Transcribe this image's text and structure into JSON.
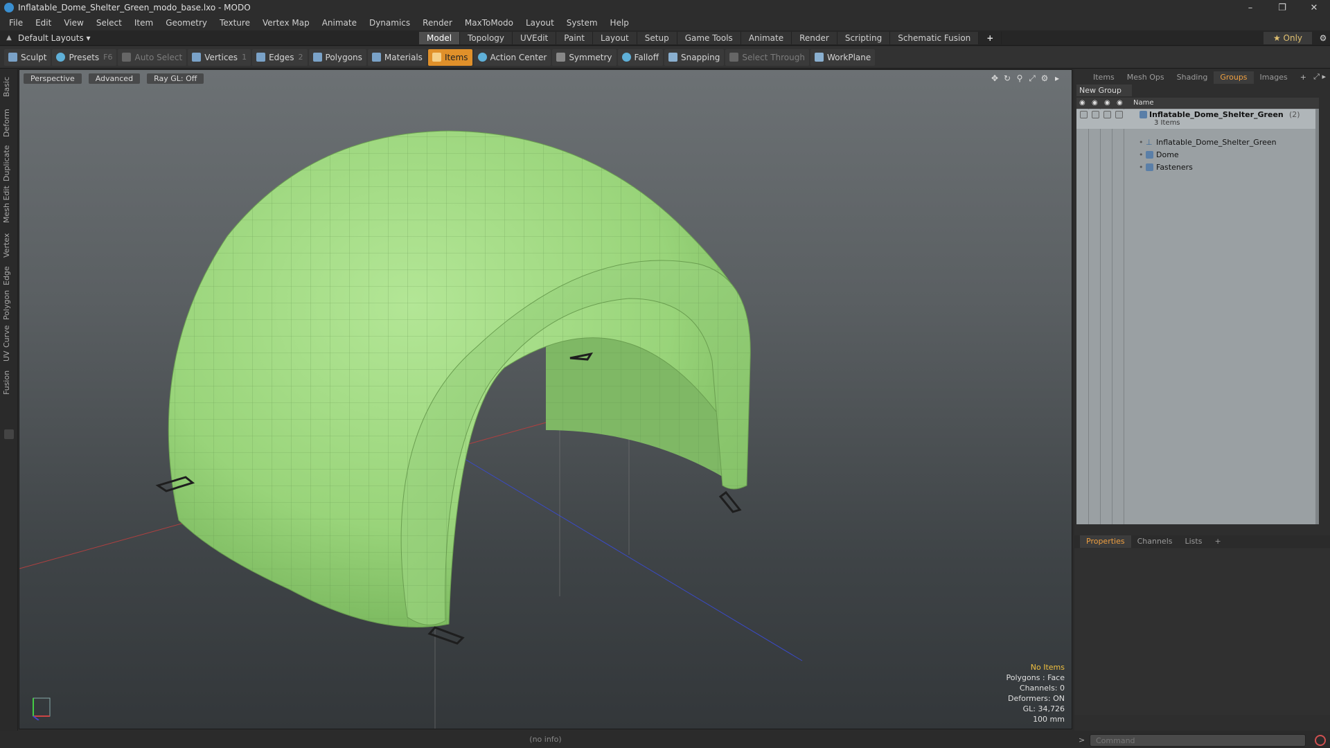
{
  "window": {
    "title": "Inflatable_Dome_Shelter_Green_modo_base.lxo - MODO",
    "minimize": "–",
    "restore": "❐",
    "close": "✕"
  },
  "menu": [
    "File",
    "Edit",
    "View",
    "Select",
    "Item",
    "Geometry",
    "Texture",
    "Vertex Map",
    "Animate",
    "Dynamics",
    "Render",
    "MaxToModo",
    "Layout",
    "System",
    "Help"
  ],
  "layoutbar": {
    "layouts": "Default Layouts ▾",
    "tabs": [
      "Model",
      "Topology",
      "UVEdit",
      "Paint",
      "Layout",
      "Setup",
      "Game Tools",
      "Animate",
      "Render",
      "Scripting",
      "Schematic Fusion"
    ],
    "active_tab": "Model",
    "add": "+",
    "only": "★ Only"
  },
  "toolbar": {
    "sculpt": "Sculpt",
    "presets": "Presets",
    "presets_key": "F6",
    "auto_select": "Auto Select",
    "vertices": "Vertices",
    "vertices_key": "1",
    "edges": "Edges",
    "edges_key": "2",
    "polygons": "Polygons",
    "materials": "Materials",
    "items": "Items",
    "action_center": "Action Center",
    "symmetry": "Symmetry",
    "falloff": "Falloff",
    "snapping": "Snapping",
    "select_through": "Select Through",
    "workplane": "WorkPlane"
  },
  "left_strip": [
    "Basic",
    "Deform",
    "Duplicate",
    "Mesh Edit",
    "Vertex",
    "Edge",
    "Polygon",
    "Curve",
    "UV",
    "Fusion"
  ],
  "viewport": {
    "view": "Perspective",
    "shading": "Advanced",
    "raygl": "Ray GL: Off",
    "stats": {
      "no_items": "No Items",
      "polygons": "Polygons : Face",
      "channels": "Channels: 0",
      "deformers": "Deformers: ON",
      "gl": "GL: 34,726",
      "unit": "100 mm"
    },
    "colors": {
      "dome": "#9bd77a",
      "dome_shadow": "#6fae54",
      "wire": "#5e8f4a"
    }
  },
  "status": "(no info)",
  "right_panel": {
    "tabs": [
      "Items",
      "Mesh Ops",
      "Shading",
      "Groups",
      "Images"
    ],
    "active_tab": "Groups",
    "add": "+",
    "new_group": "New Group",
    "column_name": "Name",
    "group": {
      "name": "Inflatable_Dome_Shelter_Green",
      "count": "(2)",
      "subtitle": "3 Items",
      "children": [
        "Inflatable_Dome_Shelter_Green",
        "Dome",
        "Fasteners"
      ]
    },
    "props_tabs": [
      "Properties",
      "Channels",
      "Lists"
    ],
    "props_active": "Properties",
    "props_add": "+",
    "command_placeholder": "Command"
  }
}
